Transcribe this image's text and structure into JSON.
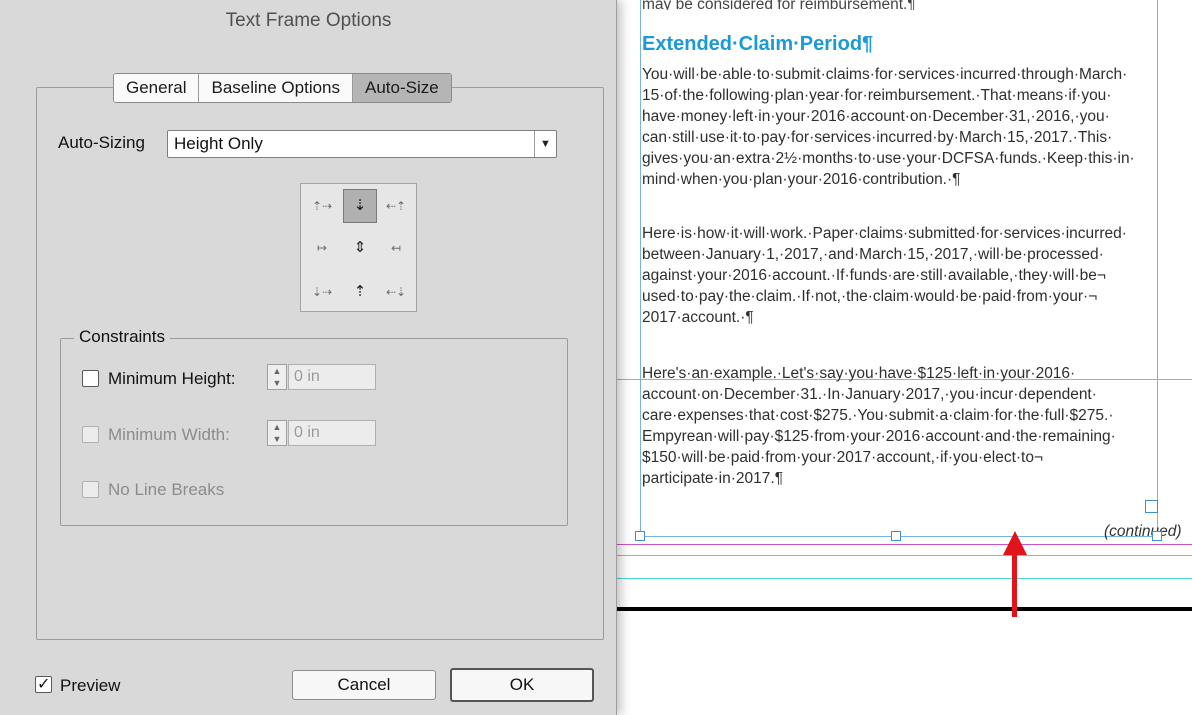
{
  "dialog": {
    "title": "Text Frame Options",
    "tabs": [
      {
        "label": "General",
        "active": false
      },
      {
        "label": "Baseline Options",
        "active": false
      },
      {
        "label": "Auto-Size",
        "active": true
      }
    ],
    "auto_sizing": {
      "label": "Auto-Sizing",
      "value": "Height Only"
    },
    "reference_point": {
      "selected": "top-center"
    },
    "constraints": {
      "legend": "Constraints",
      "min_height": {
        "label": "Minimum Height:",
        "value": "0 in",
        "checked": false,
        "enabled": true
      },
      "min_width": {
        "label": "Minimum Width:",
        "value": "0 in",
        "checked": false,
        "enabled": false
      },
      "no_line_breaks": {
        "label": "No Line Breaks",
        "checked": false,
        "enabled": false
      }
    },
    "preview": {
      "label": "Preview",
      "checked": true
    },
    "buttons": {
      "cancel": "Cancel",
      "ok": "OK"
    }
  },
  "document": {
    "cut_line": "may be considered for reimbursement.¶",
    "heading": "Extended·Claim·Period¶",
    "paragraphs": [
      "You·will·be·able·to·submit·claims·for·services·incurred·through·March·\n15·of·the·following·plan·year·for·reimbursement.·That·means·if·you·\nhave·money·left·in·your·2016·account·on·December·31,·2016,·you·\ncan·still·use·it·to·pay·for·services·incurred·by·March·15,·2017.·This·\ngives·you·an·extra·2½·months·to·use·your·DCFSA·funds.·Keep·this·in·\nmind·when·you·plan·your·2016·contribution.·¶",
      "Here·is·how·it·will·work.·Paper·claims·submitted·for·services·incurred·\nbetween·January·1,·2017,·and·March·15,·2017,·will·be·processed·\nagainst·your·2016·account.·If·funds·are·still·available,·they·will·be¬\nused·to·pay·the·claim.·If·not,·the·claim·would·be·paid·from·your·¬\n2017·account.·¶",
      "Here's·an·example.·Let's·say·you·have·$125·left·in·your·2016·\naccount·on·December·31.·In·January·2017,·you·incur·dependent·\ncare·expenses·that·cost·$275.·You·submit·a·claim·for·the·full·$275.·\nEmpyrean·will·pay·$125·from·your·2016·account·and·the·remaining·\n$150·will·be·paid·from·your·2017·account,·if·you·elect·to¬\nparticipate·in·2017.¶"
    ],
    "continued": "(continued)",
    "colors": {
      "heading": "#1b9ad6",
      "guide_cyan": "#4fd3d9",
      "guide_magenta": "#cc55cc",
      "arrow": "#e1131b"
    }
  }
}
